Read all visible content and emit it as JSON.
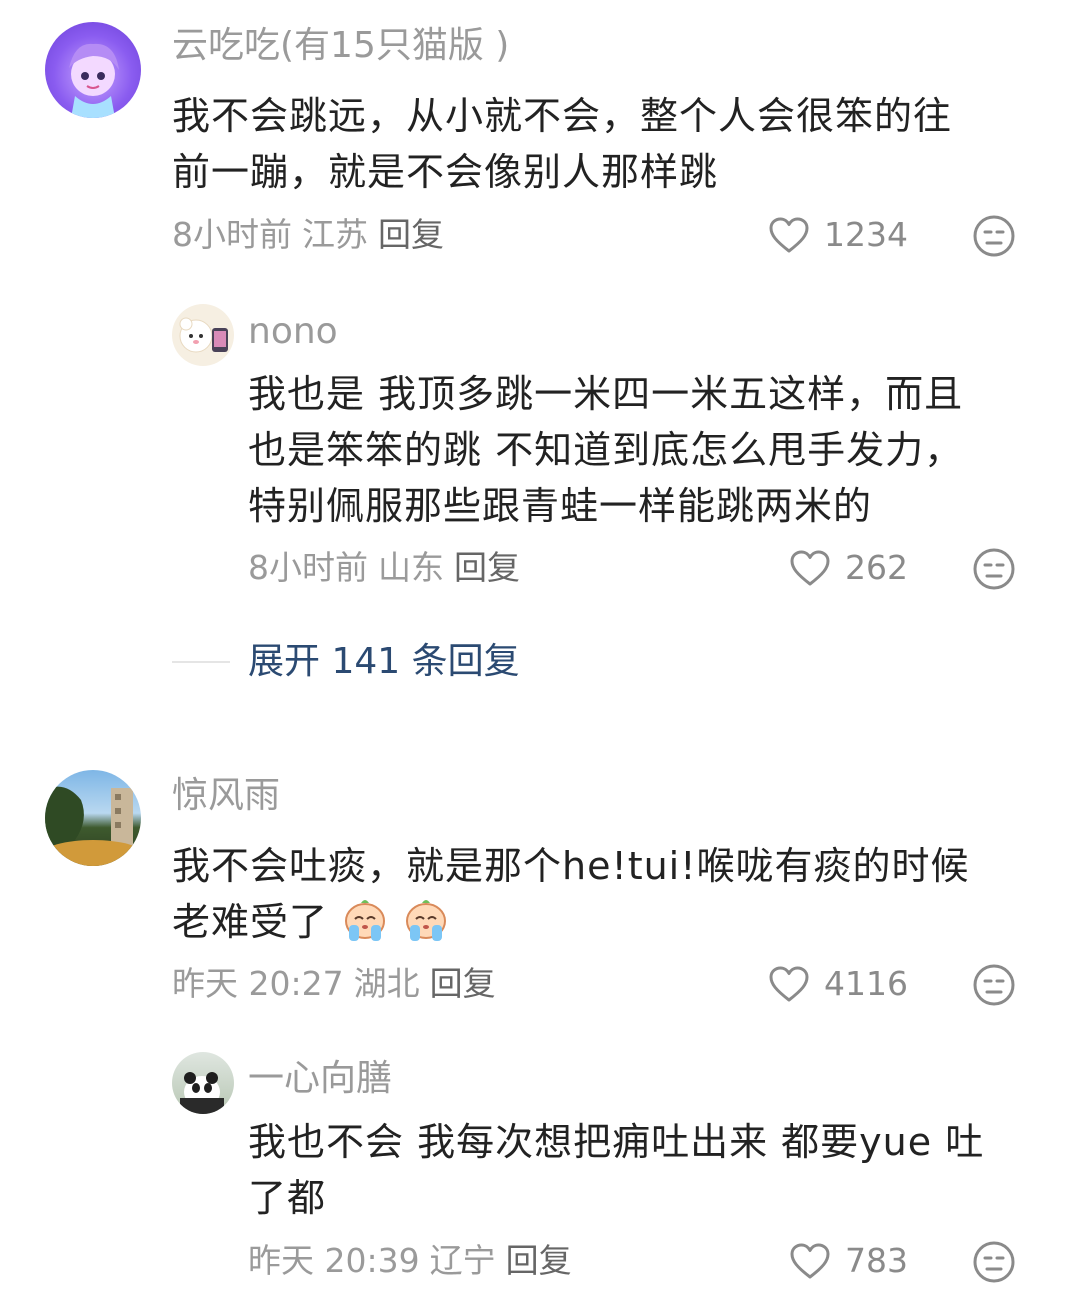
{
  "comments": [
    {
      "username": "云吃吃(有15只猫版 )",
      "text_lines": [
        "我不会跳远，从小就不会，整个人会很笨的往",
        "前一蹦，就是不会像别人那样跳"
      ],
      "time": "8小时前",
      "location": "江苏",
      "reply_label": "回复",
      "likes": "1234",
      "avatar_icon": "cartoon-girl-avatar",
      "replies": [
        {
          "username": "nono",
          "text_lines": [
            "我也是 我顶多跳一米四一米五这样，而且",
            "也是笨笨的跳 不知道到底怎么甩手发力，",
            "特别佩服那些跟青蛙一样能跳两米的"
          ],
          "time": "8小时前",
          "location": "山东",
          "reply_label": "回复",
          "likes": "262",
          "avatar_icon": "cartoon-bear-avatar"
        }
      ],
      "expand_label": "展开 141 条回复"
    },
    {
      "username": "惊风雨",
      "text_line1": "我不会吐痰，就是那个he!tui!喉咙有痰的时候",
      "text_line2": "老难受了",
      "emojis": [
        "crying-emoji",
        "crying-emoji"
      ],
      "time": "昨天 20:27",
      "location": "湖北",
      "reply_label": "回复",
      "likes": "4116",
      "avatar_icon": "tree-sky-photo-avatar",
      "replies": [
        {
          "username": "一心向膳",
          "text_lines": [
            "我也不会 我每次想把痈吐出来 都要yue 吐",
            "了都"
          ],
          "time": "昨天 20:39",
          "location": "辽宁",
          "reply_label": "回复",
          "likes": "783",
          "avatar_icon": "panda-photo-avatar"
        }
      ]
    }
  ],
  "colors": {
    "username": "#9a9a9a",
    "body": "#222222",
    "meta": "#9a9a9a",
    "expand_link": "#2b4a72"
  },
  "icons": {
    "like": "heart-outline-icon",
    "dislike": "meh-face-icon"
  }
}
